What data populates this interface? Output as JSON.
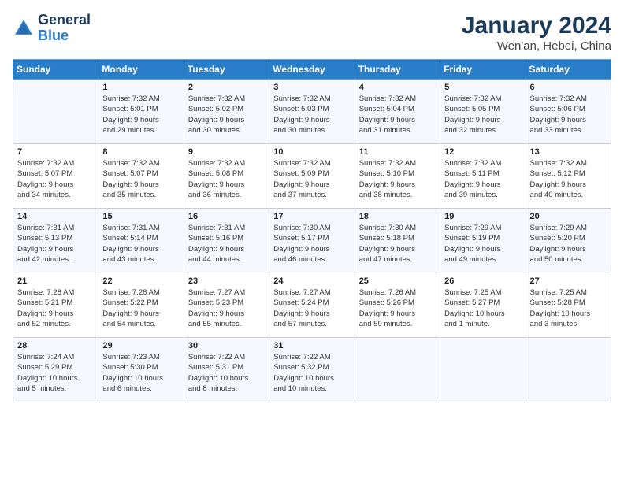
{
  "header": {
    "logo_line1": "General",
    "logo_line2": "Blue",
    "title": "January 2024",
    "subtitle": "Wen'an, Hebei, China"
  },
  "days_of_week": [
    "Sunday",
    "Monday",
    "Tuesday",
    "Wednesday",
    "Thursday",
    "Friday",
    "Saturday"
  ],
  "weeks": [
    [
      {
        "day": "",
        "info": ""
      },
      {
        "day": "1",
        "info": "Sunrise: 7:32 AM\nSunset: 5:01 PM\nDaylight: 9 hours\nand 29 minutes."
      },
      {
        "day": "2",
        "info": "Sunrise: 7:32 AM\nSunset: 5:02 PM\nDaylight: 9 hours\nand 30 minutes."
      },
      {
        "day": "3",
        "info": "Sunrise: 7:32 AM\nSunset: 5:03 PM\nDaylight: 9 hours\nand 30 minutes."
      },
      {
        "day": "4",
        "info": "Sunrise: 7:32 AM\nSunset: 5:04 PM\nDaylight: 9 hours\nand 31 minutes."
      },
      {
        "day": "5",
        "info": "Sunrise: 7:32 AM\nSunset: 5:05 PM\nDaylight: 9 hours\nand 32 minutes."
      },
      {
        "day": "6",
        "info": "Sunrise: 7:32 AM\nSunset: 5:06 PM\nDaylight: 9 hours\nand 33 minutes."
      }
    ],
    [
      {
        "day": "7",
        "info": "Sunrise: 7:32 AM\nSunset: 5:07 PM\nDaylight: 9 hours\nand 34 minutes."
      },
      {
        "day": "8",
        "info": "Sunrise: 7:32 AM\nSunset: 5:07 PM\nDaylight: 9 hours\nand 35 minutes."
      },
      {
        "day": "9",
        "info": "Sunrise: 7:32 AM\nSunset: 5:08 PM\nDaylight: 9 hours\nand 36 minutes."
      },
      {
        "day": "10",
        "info": "Sunrise: 7:32 AM\nSunset: 5:09 PM\nDaylight: 9 hours\nand 37 minutes."
      },
      {
        "day": "11",
        "info": "Sunrise: 7:32 AM\nSunset: 5:10 PM\nDaylight: 9 hours\nand 38 minutes."
      },
      {
        "day": "12",
        "info": "Sunrise: 7:32 AM\nSunset: 5:11 PM\nDaylight: 9 hours\nand 39 minutes."
      },
      {
        "day": "13",
        "info": "Sunrise: 7:32 AM\nSunset: 5:12 PM\nDaylight: 9 hours\nand 40 minutes."
      }
    ],
    [
      {
        "day": "14",
        "info": "Sunrise: 7:31 AM\nSunset: 5:13 PM\nDaylight: 9 hours\nand 42 minutes."
      },
      {
        "day": "15",
        "info": "Sunrise: 7:31 AM\nSunset: 5:14 PM\nDaylight: 9 hours\nand 43 minutes."
      },
      {
        "day": "16",
        "info": "Sunrise: 7:31 AM\nSunset: 5:16 PM\nDaylight: 9 hours\nand 44 minutes."
      },
      {
        "day": "17",
        "info": "Sunrise: 7:30 AM\nSunset: 5:17 PM\nDaylight: 9 hours\nand 46 minutes."
      },
      {
        "day": "18",
        "info": "Sunrise: 7:30 AM\nSunset: 5:18 PM\nDaylight: 9 hours\nand 47 minutes."
      },
      {
        "day": "19",
        "info": "Sunrise: 7:29 AM\nSunset: 5:19 PM\nDaylight: 9 hours\nand 49 minutes."
      },
      {
        "day": "20",
        "info": "Sunrise: 7:29 AM\nSunset: 5:20 PM\nDaylight: 9 hours\nand 50 minutes."
      }
    ],
    [
      {
        "day": "21",
        "info": "Sunrise: 7:28 AM\nSunset: 5:21 PM\nDaylight: 9 hours\nand 52 minutes."
      },
      {
        "day": "22",
        "info": "Sunrise: 7:28 AM\nSunset: 5:22 PM\nDaylight: 9 hours\nand 54 minutes."
      },
      {
        "day": "23",
        "info": "Sunrise: 7:27 AM\nSunset: 5:23 PM\nDaylight: 9 hours\nand 55 minutes."
      },
      {
        "day": "24",
        "info": "Sunrise: 7:27 AM\nSunset: 5:24 PM\nDaylight: 9 hours\nand 57 minutes."
      },
      {
        "day": "25",
        "info": "Sunrise: 7:26 AM\nSunset: 5:26 PM\nDaylight: 9 hours\nand 59 minutes."
      },
      {
        "day": "26",
        "info": "Sunrise: 7:25 AM\nSunset: 5:27 PM\nDaylight: 10 hours\nand 1 minute."
      },
      {
        "day": "27",
        "info": "Sunrise: 7:25 AM\nSunset: 5:28 PM\nDaylight: 10 hours\nand 3 minutes."
      }
    ],
    [
      {
        "day": "28",
        "info": "Sunrise: 7:24 AM\nSunset: 5:29 PM\nDaylight: 10 hours\nand 5 minutes."
      },
      {
        "day": "29",
        "info": "Sunrise: 7:23 AM\nSunset: 5:30 PM\nDaylight: 10 hours\nand 6 minutes."
      },
      {
        "day": "30",
        "info": "Sunrise: 7:22 AM\nSunset: 5:31 PM\nDaylight: 10 hours\nand 8 minutes."
      },
      {
        "day": "31",
        "info": "Sunrise: 7:22 AM\nSunset: 5:32 PM\nDaylight: 10 hours\nand 10 minutes."
      },
      {
        "day": "",
        "info": ""
      },
      {
        "day": "",
        "info": ""
      },
      {
        "day": "",
        "info": ""
      }
    ]
  ]
}
